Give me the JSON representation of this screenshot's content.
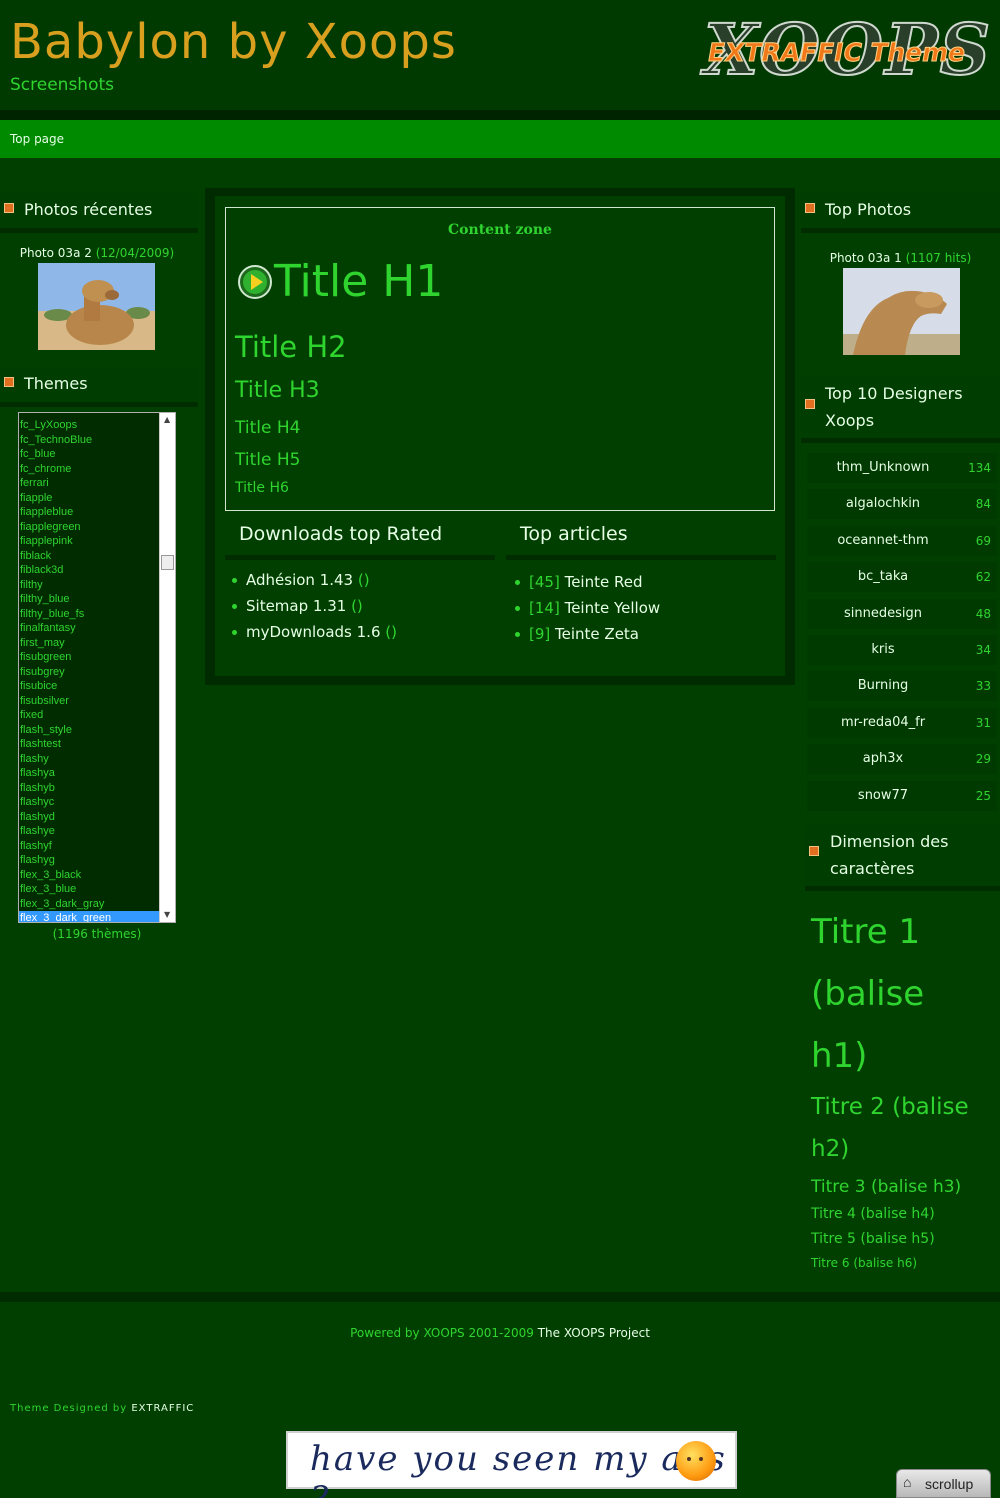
{
  "header": {
    "site_name": "Babylon by Xoops",
    "slogan": "Screenshots",
    "logo_main": "XOOPS",
    "logo_sub": "EXTRAFFIC Theme"
  },
  "nav": {
    "top_page": "Top page"
  },
  "left": {
    "recent_photos": {
      "title": "Photos récentes",
      "photo_name": "Photo 03a 2",
      "photo_date": "(12/04/2009)"
    },
    "themes": {
      "title": "Themes",
      "items": [
        "fc_LyXoops",
        "fc_TechnoBlue",
        "fc_blue",
        "fc_chrome",
        "ferrari",
        "fiapple",
        "fiappleblue",
        "fiapplegreen",
        "fiapplepink",
        "fiblack",
        "fiblack3d",
        "filthy",
        "filthy_blue",
        "filthy_blue_fs",
        "finalfantasy",
        "first_may",
        "fisubgreen",
        "fisubgrey",
        "fisubice",
        "fisubsilver",
        "fixed",
        "flash_style",
        "flashtest",
        "flashy",
        "flashya",
        "flashyb",
        "flashyc",
        "flashyd",
        "flashye",
        "flashyf",
        "flashyg",
        "flex_3_black",
        "flex_3_blue",
        "flex_3_dark_gray",
        "flex_3_dark_green"
      ],
      "selected": "flex_3_dark_green",
      "count_label": "(1196 thèmes)"
    }
  },
  "center": {
    "content_zone_label": "Content zone",
    "h1": "Title H1",
    "h2": "Title H2",
    "h3": "Title H3",
    "h4": "Title H4",
    "h5": "Title H5",
    "h6": "Title H6",
    "downloads": {
      "title": "Downloads top Rated",
      "items": [
        {
          "name": "Adhésion 1.43",
          "extra": "()"
        },
        {
          "name": "Sitemap 1.31",
          "extra": "()"
        },
        {
          "name": "myDownloads 1.6",
          "extra": "()"
        }
      ]
    },
    "articles": {
      "title": "Top articles",
      "items": [
        {
          "count": "[45]",
          "name": "Teinte Red"
        },
        {
          "count": "[14]",
          "name": "Teinte Yellow"
        },
        {
          "count": "[9]",
          "name": "Teinte Zeta"
        }
      ]
    }
  },
  "right": {
    "top_photos": {
      "title": "Top Photos",
      "photo_name": "Photo 03a 1",
      "photo_hits": "(1107 hits)"
    },
    "designers": {
      "title_line1": "Top 10 Designers",
      "title_line2": "Xoops",
      "items": [
        {
          "name": "thm_Unknown",
          "count": "134"
        },
        {
          "name": "algalochkin",
          "count": "84"
        },
        {
          "name": "oceannet-thm",
          "count": "69"
        },
        {
          "name": "bc_taka",
          "count": "62"
        },
        {
          "name": "sinnedesign",
          "count": "48"
        },
        {
          "name": "kris",
          "count": "34"
        },
        {
          "name": "Burning",
          "count": "33"
        },
        {
          "name": "mr-reda04_fr",
          "count": "31"
        },
        {
          "name": "aph3x",
          "count": "29"
        },
        {
          "name": "snow77",
          "count": "25"
        }
      ]
    },
    "dimensions": {
      "title_line1": "Dimension des",
      "title_line2": "caractères",
      "t1_l1": "Titre 1",
      "t1_l2": "(balise",
      "t1_l3": "h1)",
      "t2_l1": "Titre 2 (balise",
      "t2_l2": "h2)",
      "t3": "Titre 3 (balise h3)",
      "t4": "Titre 4 (balise h4)",
      "t5": "Titre 5 (balise h5)",
      "t6": "Titre 6 (balise h6)"
    }
  },
  "footer": {
    "powered_prefix": "Powered by XOOPS 2001-2009",
    "powered_link": "The XOOPS Project",
    "designed_prefix": "Theme Designed by",
    "designed_link": "EXTRAFFIC",
    "ads_text": "have you seen my ads ?",
    "scrollup": "scrollup"
  },
  "colors": {
    "accent_green": "#2fd42f",
    "site_name": "#d9a020",
    "nav_bar": "#008a00",
    "bullet_square": "#e07020",
    "background": "#003f00"
  }
}
